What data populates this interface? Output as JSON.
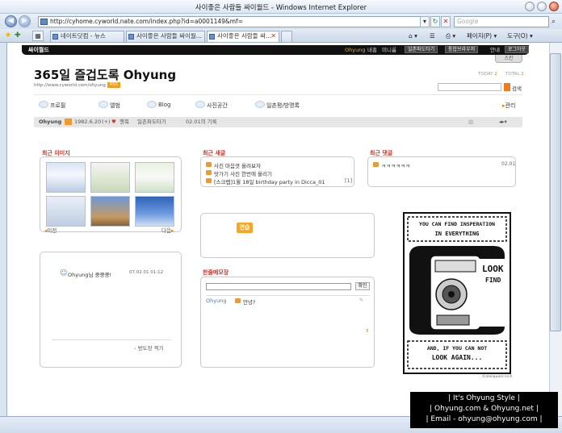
{
  "browser": {
    "window_title": "사이좋은 사람들 싸이월드 - Windows Internet Explorer",
    "url": "http://cyhome.cyworld.nate.com/index.php?id=a0001149&mf=",
    "search_placeholder": "Google",
    "tabs": [
      {
        "label": "네이트닷컴 - 뉴스"
      },
      {
        "label": "사이좋은 사람들 싸이월..."
      },
      {
        "label": "사이좋은 사람들 싸..."
      }
    ],
    "commands": {
      "page": "페이지(P)",
      "tools": "도구(O)"
    }
  },
  "cyworld": {
    "strip_logo": "싸이월드",
    "strip_user": "Ohyung",
    "strip_items": [
      "내홈",
      "미니룸",
      "일촌파도타기",
      "통합브라우저",
      "안내"
    ],
    "strip_logout": "로그아웃",
    "skin_tab": "스킨",
    "home_title": "365일 즐겁도록 Ohyung",
    "home_url": "http://www.cyworld.com/ohyung",
    "rss_label": "RSS",
    "today_label": "TODAY",
    "today_value": "2",
    "total_label": "TOTAL",
    "total_value": "2",
    "search_button": "검색",
    "menu": [
      "프로필",
      "앨범",
      "Blog",
      "사진공간",
      "일촌평/방명록"
    ],
    "manage_label": "관리",
    "profile_bar": {
      "name": "Ohyung",
      "birth": "1982.6.20",
      "mood": "행복",
      "surf": "일촌파도타기",
      "record": "02.01의 기록"
    },
    "sections": {
      "recent_images": "최근 이미지",
      "recent_posts": "최근 새글",
      "recent_comments": "최근 댓글",
      "guestbook": "한줄메모장"
    },
    "images_nav": {
      "prev": "이전",
      "next": "다음"
    },
    "recent_posts": [
      {
        "title": "사진 마음껏 올려보자",
        "count": ""
      },
      {
        "title": "맛가기 사진 한번에 올리기",
        "count": ""
      },
      {
        "title": "[스크랩]1월 18일 birthday party in Dicca_01",
        "count": "[1]"
      }
    ],
    "recent_comment": {
      "text": "ㅋㅋㅋㅋㅋㅋ",
      "date": "02.01"
    },
    "memo_badge": "연습",
    "visitor": {
      "text": "Ohyung님 쿵쿵쿵!",
      "date": "07.02.01 01:12"
    },
    "visitor_link": "방도장 찍기",
    "guestbook_post_button": "확인",
    "guestbook_entry": {
      "name": "Ohyung",
      "text": "안녕?"
    },
    "poster": {
      "line1": "YOU CAN FIND INSPERATION",
      "line2": "IN EVERYTHING",
      "line3": "LOOK",
      "line4": "FIND",
      "line5": "AND, IF YOU CAN NOT",
      "line6": "LOOK AGAIN...",
      "credit": "©olesquare inch"
    }
  },
  "signature": {
    "line1": "| It's Ohyung Style |",
    "line2": "| Ohyung.com & Ohyung.net |",
    "line3": "| Email - ohyung@ohyung.com |"
  },
  "colors": {
    "accent": "#f09a2e",
    "section_title": "#c8342a",
    "strip": "#111111"
  }
}
